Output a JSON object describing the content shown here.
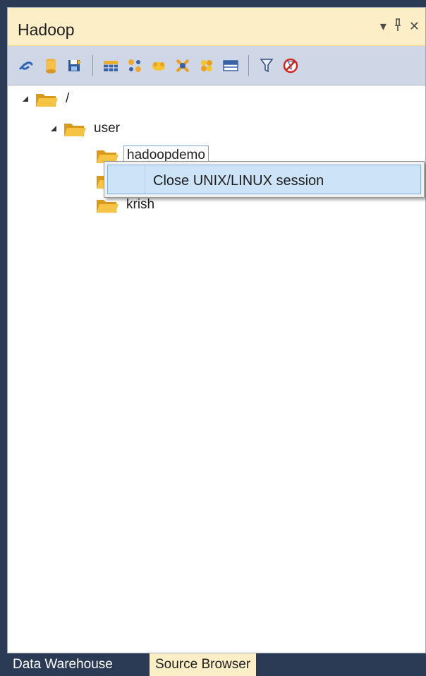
{
  "panel": {
    "title": "Hadoop",
    "dropdown_glyph": "▾",
    "pin_glyph": "ᚆ",
    "close_glyph": "✕"
  },
  "toolbar": {
    "icons": [
      "connect-icon",
      "database-icon",
      "save-icon",
      "table-icon",
      "transform-icon",
      "hadoop-icon",
      "join-icon",
      "hadoop-node-icon",
      "grid-icon",
      "filter-icon",
      "no-filter-icon"
    ]
  },
  "tree": {
    "root": {
      "label": "/"
    },
    "user": {
      "label": "user"
    },
    "hadoopdemo": {
      "label": "hadoopdemo"
    },
    "hidden_child": {
      "label": ""
    },
    "krish": {
      "label": "krish"
    }
  },
  "context_menu": {
    "items": [
      {
        "label": "Close UNIX/LINUX session"
      }
    ]
  },
  "tabs": [
    {
      "label": "Data Warehouse"
    },
    {
      "label": "Source Browser"
    }
  ],
  "colors": {
    "titlebar_bg": "#fcefc8",
    "toolbar_bg": "#cfd6e5",
    "menu_highlight": "#cde3f7",
    "frame": "#2b3a55"
  }
}
